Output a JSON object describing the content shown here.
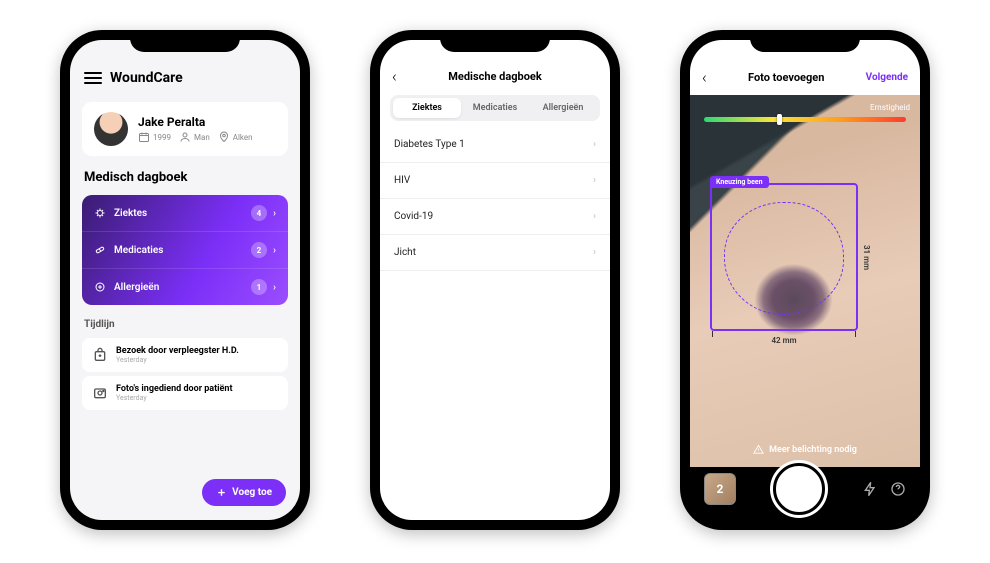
{
  "screen1": {
    "app_title": "WoundCare",
    "patient": {
      "name": "Jake Peralta",
      "year": "1999",
      "gender": "Man",
      "location": "Alken"
    },
    "section_title": "Medisch dagboek",
    "diary": [
      {
        "label": "Ziektes",
        "count": "4"
      },
      {
        "label": "Medicaties",
        "count": "2"
      },
      {
        "label": "Allergieën",
        "count": "1"
      }
    ],
    "timeline_title": "Tijdlijn",
    "timeline": [
      {
        "title": "Bezoek door verpleegster H.D.",
        "date": "Yesterday"
      },
      {
        "title": "Foto's ingediend door patiënt",
        "date": "Yesterday"
      }
    ],
    "fab_label": "Voeg toe"
  },
  "screen2": {
    "title": "Medische dagboek",
    "tabs": [
      "Ziektes",
      "Medicaties",
      "Allergieën"
    ],
    "active_tab": "Ziektes",
    "items": [
      "Diabetes Type 1",
      "HIV",
      "Covid-19",
      "Jicht"
    ]
  },
  "screen3": {
    "title": "Foto toevoegen",
    "next_label": "Volgende",
    "severity_label": "Ernstigheid",
    "wound_label": "Kneuzing been",
    "width_mm": "42 mm",
    "height_mm": "31 mm",
    "warning": "Meer belichting nodig",
    "photo_count": "2"
  }
}
